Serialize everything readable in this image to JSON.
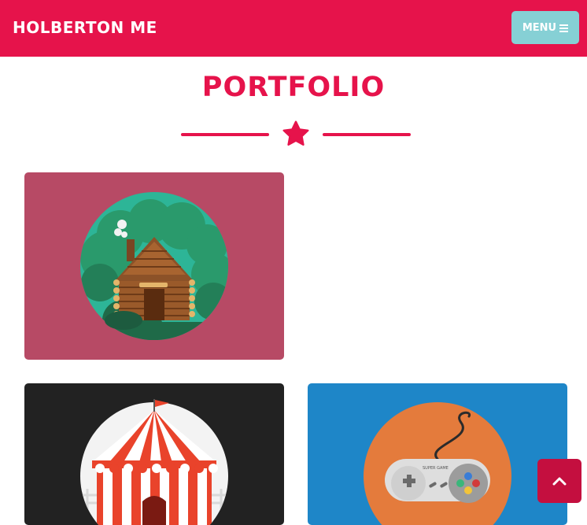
{
  "navbar": {
    "brand": "HOLBERTON ME",
    "menu_label": "MENU",
    "menu_icon": "bars-icon"
  },
  "portfolio": {
    "title": "PORTFOLIO",
    "divider_icon": "star-icon",
    "items": [
      {
        "name": "cabin",
        "icon": "cabin-icon",
        "background": "#b74a65"
      },
      {
        "name": "circus",
        "icon": "circus-tent-icon",
        "background": "#222222"
      },
      {
        "name": "game",
        "icon": "game-controller-icon",
        "background": "#1e86c8",
        "controller_text": "SUPER GAME"
      }
    ]
  },
  "back_to_top": {
    "icon": "chevron-up-icon"
  },
  "colors": {
    "brand": "#e6134b",
    "menu_button": "#86d0d5",
    "back_to_top": "#c40f3f",
    "cabin_bg": "#b74a65",
    "circus_bg": "#222222",
    "game_bg": "#1e86c8"
  }
}
